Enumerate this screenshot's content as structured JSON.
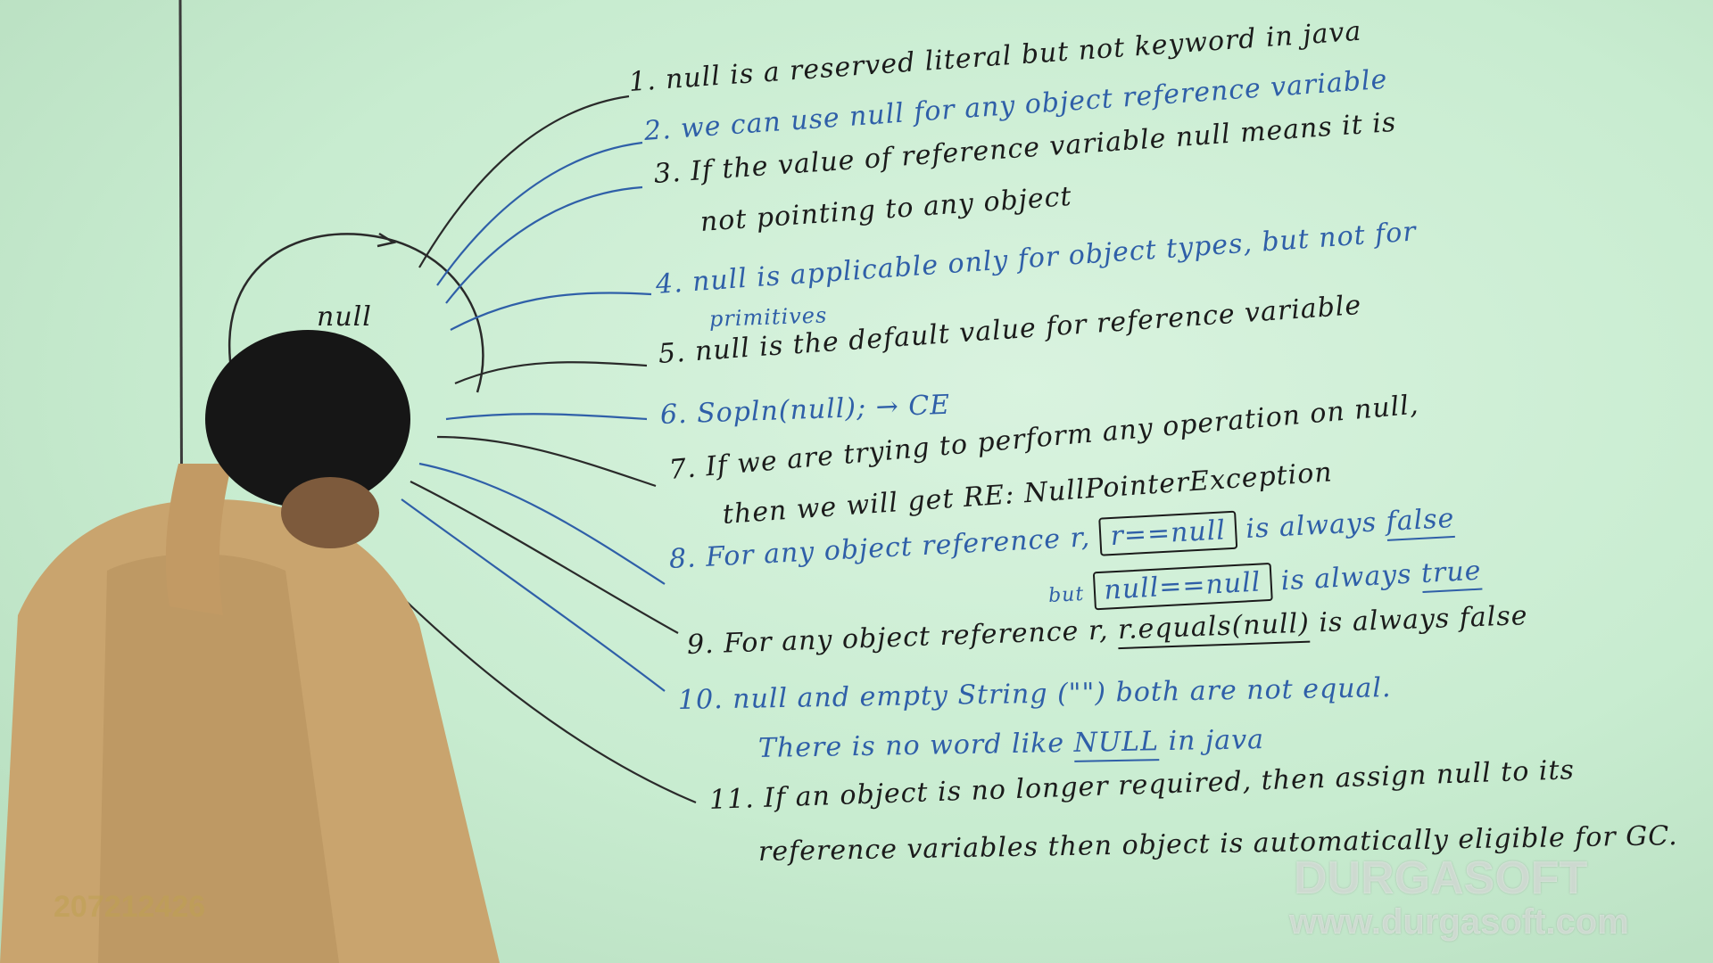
{
  "board": {
    "center_label": "null",
    "notes": [
      {
        "id": "n1",
        "text": "1. null is a reserved literal but not keyword in java"
      },
      {
        "id": "n2",
        "text": "2. we can use null for any object reference variable"
      },
      {
        "id": "n3a",
        "text": "3. If the value of reference variable null means it is"
      },
      {
        "id": "n3b",
        "text": "not pointing to any object"
      },
      {
        "id": "n4a",
        "text": "4. null is applicable only for object types, but not for"
      },
      {
        "id": "n4b",
        "text": "primitives"
      },
      {
        "id": "n5",
        "text": "5. null is the default value for reference variable"
      },
      {
        "id": "n6",
        "text": "6. Sopln(null); → CE"
      },
      {
        "id": "n7a",
        "text": "7. If we are trying to perform any operation on null,"
      },
      {
        "id": "n7b",
        "text": "then we will get RE: NullPointerException"
      },
      {
        "id": "n8a_pre",
        "text": "8. For any object reference r,"
      },
      {
        "id": "n8a_box",
        "text": "r==null"
      },
      {
        "id": "n8a_post",
        "text": "is always"
      },
      {
        "id": "n8a_word",
        "text": "false"
      },
      {
        "id": "n8b_pre",
        "text": "but"
      },
      {
        "id": "n8b_box",
        "text": "null==null"
      },
      {
        "id": "n8b_post",
        "text": "is always"
      },
      {
        "id": "n8b_word",
        "text": "true"
      },
      {
        "id": "n9_pre",
        "text": "9. For any object reference r,"
      },
      {
        "id": "n9_code",
        "text": "r.equals(null)"
      },
      {
        "id": "n9_post",
        "text": "is always false"
      },
      {
        "id": "n10a",
        "text": "10. null and empty String (\"\") both are not equal."
      },
      {
        "id": "n10b_pre",
        "text": "There is no word like"
      },
      {
        "id": "n10b_word",
        "text": "NULL"
      },
      {
        "id": "n10b_post",
        "text": "in java"
      },
      {
        "id": "n11a",
        "text": "11. If an object is no longer required, then assign null to its"
      },
      {
        "id": "n11b",
        "text": "reference variables then object is automatically eligible for GC."
      }
    ]
  },
  "overlay": {
    "watermark_logo": "DURGASOFT",
    "watermark_url": "www.durgasoft.com",
    "phone": "207212426"
  },
  "colors": {
    "board": "#c8ecd0",
    "ink_black": "#1b1b1b",
    "ink_blue": "#2f5fa8",
    "shirt": "#c9a46e",
    "hair": "#161616"
  }
}
